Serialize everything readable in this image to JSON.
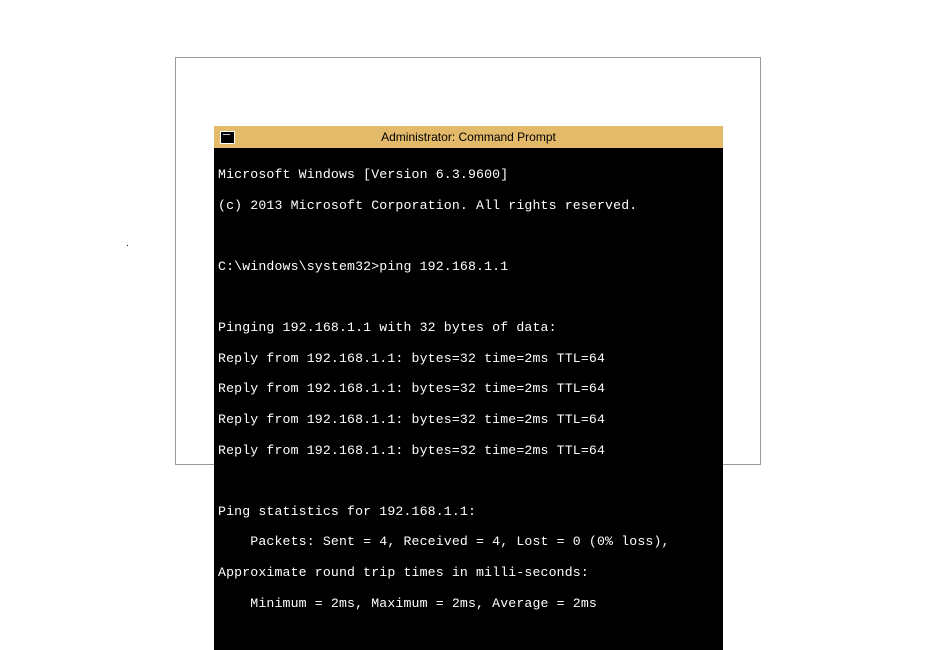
{
  "window": {
    "title": "Administrator: Command Prompt"
  },
  "lines": {
    "l0": "Microsoft Windows [Version 6.3.9600]",
    "l1": "(c) 2013 Microsoft Corporation. All rights reserved.",
    "l2": "C:\\windows\\system32>ping 192.168.1.1",
    "l3": "Pinging 192.168.1.1 with 32 bytes of data:",
    "l4": "Reply from 192.168.1.1: bytes=32 time=2ms TTL=64",
    "l5": "Reply from 192.168.1.1: bytes=32 time=2ms TTL=64",
    "l6": "Reply from 192.168.1.1: bytes=32 time=2ms TTL=64",
    "l7": "Reply from 192.168.1.1: bytes=32 time=2ms TTL=64",
    "l8": "Ping statistics for 192.168.1.1:",
    "l9": "    Packets: Sent = 4, Received = 4, Lost = 0 (0% loss),",
    "l10": "Approximate round trip times in milli-seconds:",
    "l11": "    Minimum = 2ms, Maximum = 2ms, Average = 2ms"
  },
  "dot": "."
}
